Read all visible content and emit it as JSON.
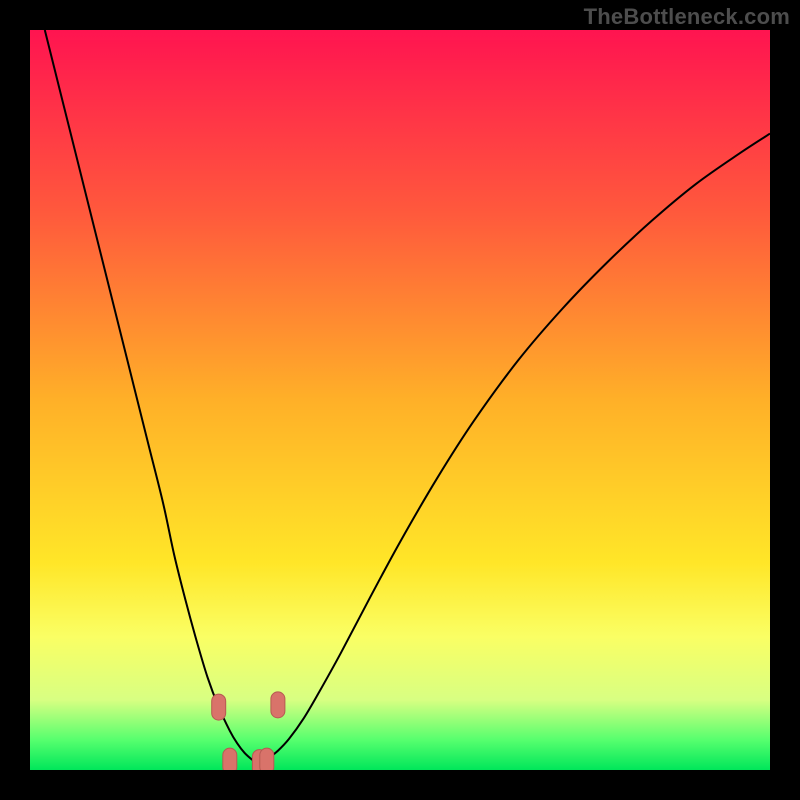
{
  "watermark": "TheBottleneck.com",
  "colors": {
    "frame_bg": "#000000",
    "curve": "#000000",
    "marker_fill": "#d9736a",
    "marker_stroke": "#b65a52",
    "gradient_stops": [
      {
        "offset": 0.0,
        "color": "#ff1450"
      },
      {
        "offset": 0.25,
        "color": "#ff5a3c"
      },
      {
        "offset": 0.5,
        "color": "#ffb028"
      },
      {
        "offset": 0.72,
        "color": "#ffe628"
      },
      {
        "offset": 0.82,
        "color": "#faff64"
      },
      {
        "offset": 0.905,
        "color": "#d8ff82"
      },
      {
        "offset": 0.96,
        "color": "#55ff6e"
      },
      {
        "offset": 1.0,
        "color": "#00e65a"
      }
    ]
  },
  "chart_data": {
    "type": "line",
    "title": "",
    "xlabel": "",
    "ylabel": "",
    "xlim": [
      0,
      100
    ],
    "ylim": [
      0,
      100
    ],
    "grid": false,
    "legend": false,
    "series": [
      {
        "name": "curve",
        "x": [
          2,
          4,
          6,
          8,
          10,
          12,
          14,
          16,
          18,
          19.5,
          21,
          22.5,
          24,
          25.5,
          27,
          28,
          29,
          30,
          30.5,
          31,
          31.5,
          32,
          33.5,
          35,
          37,
          39,
          42,
          46,
          50,
          55,
          60,
          66,
          72,
          78,
          84,
          90,
          96,
          100
        ],
        "y": [
          100,
          92,
          84,
          76,
          68,
          60,
          52,
          44,
          36,
          29,
          23,
          17.5,
          12.5,
          8.5,
          5.3,
          3.6,
          2.3,
          1.4,
          1.1,
          1.0,
          1.1,
          1.4,
          2.6,
          4.2,
          7.0,
          10.4,
          15.8,
          23.4,
          30.8,
          39.4,
          47.2,
          55.4,
          62.4,
          68.6,
          74.2,
          79.2,
          83.4,
          86.0
        ]
      }
    ],
    "markers": [
      {
        "x": 25.5,
        "y": 8.5
      },
      {
        "x": 27.0,
        "y": 1.2
      },
      {
        "x": 31.0,
        "y": 1.0
      },
      {
        "x": 32.0,
        "y": 1.2
      },
      {
        "x": 33.5,
        "y": 8.8
      }
    ]
  }
}
